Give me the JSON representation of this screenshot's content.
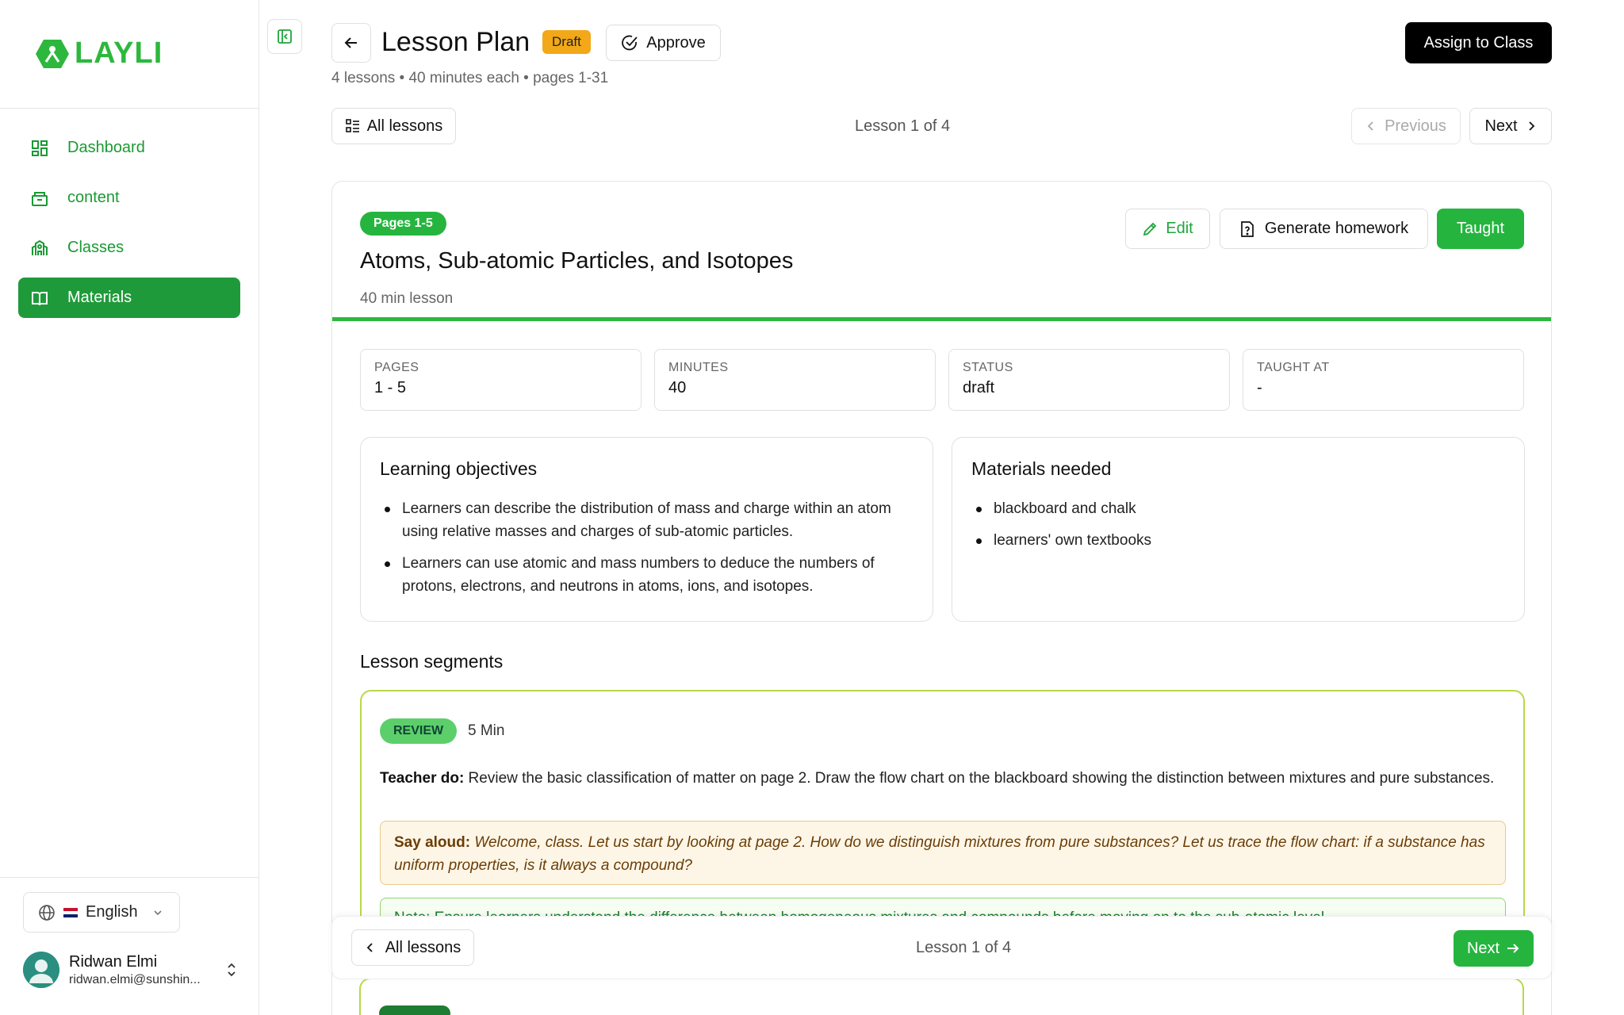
{
  "app": {
    "logo_text": "LAYLI"
  },
  "sidebar": {
    "items": [
      {
        "label": "Dashboard",
        "icon": "dashboard-icon"
      },
      {
        "label": "content",
        "icon": "box-icon"
      },
      {
        "label": "Classes",
        "icon": "school-icon"
      },
      {
        "label": "Materials",
        "icon": "book-icon",
        "active": true
      }
    ],
    "language": "English",
    "user": {
      "name": "Ridwan Elmi",
      "email": "ridwan.elmi@sunshin..."
    }
  },
  "header": {
    "title": "Lesson Plan",
    "badge": "Draft",
    "approve_label": "Approve",
    "subtitle": "4 lessons • 40 minutes each • pages 1-31",
    "assign_label": "Assign to Class"
  },
  "nav_top": {
    "all_lessons": "All lessons",
    "position": "Lesson 1 of 4",
    "previous": "Previous",
    "next": "Next"
  },
  "lesson": {
    "pages_pill": "Pages 1-5",
    "title": "Atoms, Sub-atomic Particles, and Isotopes",
    "meta": "40 min lesson",
    "edit_label": "Edit",
    "generate_label": "Generate homework",
    "taught_label": "Taught",
    "stats": [
      {
        "label": "PAGES",
        "value": "1 - 5"
      },
      {
        "label": "MINUTES",
        "value": "40"
      },
      {
        "label": "STATUS",
        "value": "draft"
      },
      {
        "label": "TAUGHT AT",
        "value": "-"
      }
    ],
    "objectives": {
      "title": "Learning objectives",
      "items": [
        "Learners can describe the distribution of mass and charge within an atom using relative masses and charges of sub-atomic particles.",
        "Learners can use atomic and mass numbers to deduce the numbers of protons, electrons, and neutrons in atoms, ions, and isotopes."
      ]
    },
    "materials": {
      "title": "Materials needed",
      "items": [
        "blackboard and chalk",
        "learners' own textbooks"
      ]
    },
    "segments_title": "Lesson segments",
    "segment": {
      "tag": "REVIEW",
      "duration": "5 Min",
      "teacher_label": "Teacher do:",
      "teacher_text": " Review the basic classification of matter on page 2. Draw the flow chart on the blackboard showing the distinction between mixtures and pure substances.",
      "say_label": "Say aloud:",
      "say_text": "Welcome, class. Let us start by looking at page 2. How do we distinguish mixtures from pure substances? Let us trace the flow chart: if a substance has uniform properties, is it always a compound?",
      "note_text": "Note: Ensure learners understand the difference between homogeneous mixtures and compounds before moving on to the sub-atomic level."
    }
  },
  "bottom_bar": {
    "all_lessons": "All lessons",
    "position": "Lesson 1 of 4",
    "next": "Next"
  },
  "colors": {
    "accent": "#25b53f",
    "draft": "#f2a818",
    "dark": "#000000"
  }
}
